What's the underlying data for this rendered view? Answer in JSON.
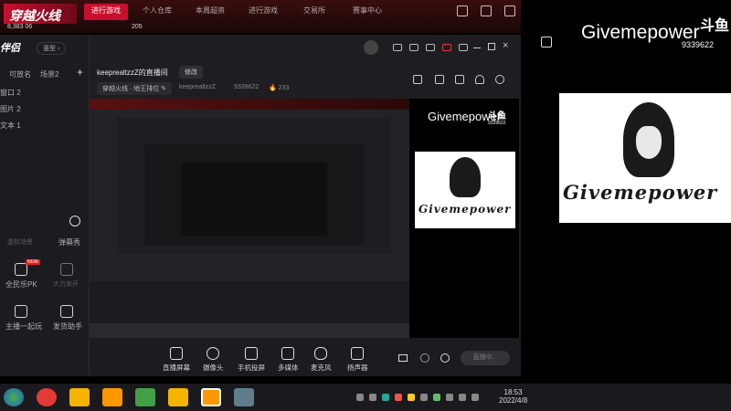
{
  "game_bar": {
    "logo": "穿越火线",
    "tabs": [
      {
        "label": "进行游戏",
        "active": true
      },
      {
        "label": "个人仓库",
        "active": false
      },
      {
        "label": "本周超资",
        "active": false
      },
      {
        "label": "进行游戏",
        "active": false
      },
      {
        "label": "交易所",
        "active": false
      },
      {
        "label": "赛事中心",
        "active": false
      }
    ],
    "partial_number": "8,383 06",
    "partial_value": "205"
  },
  "app": {
    "brand": "伴侣",
    "mode_label": "竖型",
    "sidebar": {
      "tab_active": "可放名",
      "tab_other": "场景2",
      "add_symbol": "+",
      "sources": [
        "窗口 2",
        "图片 2",
        "文本 1"
      ],
      "muted_label": "虚拟场景",
      "bullet_label": "弹幕秀",
      "items": [
        {
          "label": "全民乐PK",
          "badge": "NEW"
        },
        {
          "label": "大力发开"
        },
        {
          "label": "主播一起玩"
        },
        {
          "label": "发货助手"
        }
      ]
    },
    "header": {
      "title": "keeprealtzzZ的直播间",
      "edit_label": "修改",
      "category": "穿越火线 · 地王排位",
      "username": "keeprealtzzZ",
      "user_id": "9339622",
      "viewers": "233"
    },
    "toolbar": [
      {
        "label": "直播屏幕",
        "icon": "screen-icon"
      },
      {
        "label": "摄像头",
        "icon": "camera-icon"
      },
      {
        "label": "手机投屏",
        "icon": "phone-icon"
      },
      {
        "label": "多媒体",
        "icon": "media-icon"
      },
      {
        "label": "麦克风",
        "icon": "mic-icon"
      },
      {
        "label": "扬声器",
        "icon": "speaker-icon"
      }
    ],
    "start_button": "直播中..."
  },
  "webcam": {
    "name": "Givemepower",
    "id": "9339622",
    "logo_text": "Givemepower",
    "brand_mark": "斗鱼"
  },
  "taskbar": {
    "time": "18:53",
    "date": "2022/4/8"
  }
}
